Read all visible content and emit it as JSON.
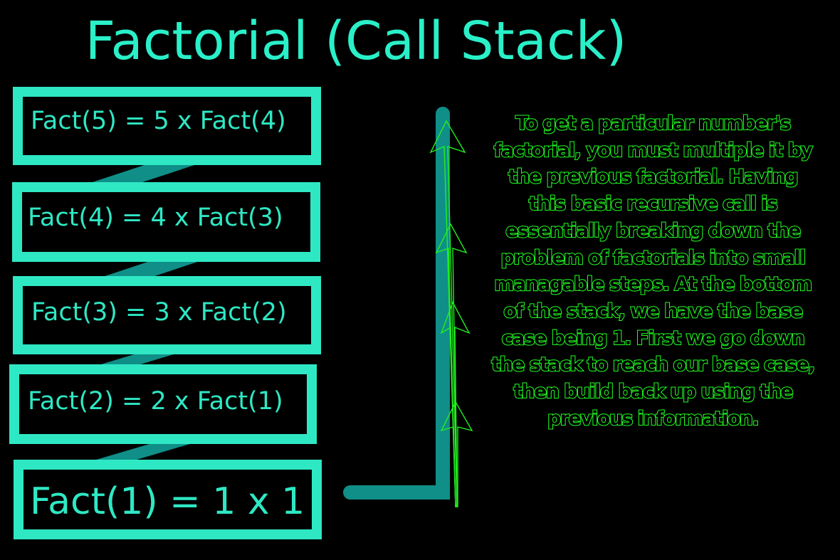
{
  "title": "Factorial (Call Stack)",
  "stack_frames": [
    {
      "label": "Fact(5) = 5 x Fact(4)"
    },
    {
      "label": "Fact(4) = 4 x Fact(3)"
    },
    {
      "label": "Fact(3) = 3 x Fact(2)"
    },
    {
      "label": "Fact(2) = 2 x Fact(1)"
    },
    {
      "label": "Fact(1) = 1 x 1"
    }
  ],
  "explanation": "To get a particular number's factorial, you must multiple it by the previous factorial. Having this basic recursive call is essentially breaking down the problem of factorials into small managable steps. At the bottom of the stack, we have the base case being 1. First we go down the stack to reach our base case, then build back up using the previous information.",
  "colors": {
    "frame": "#2ee8c4",
    "connector": "#0f8f88",
    "explanation": "#22ff22"
  }
}
